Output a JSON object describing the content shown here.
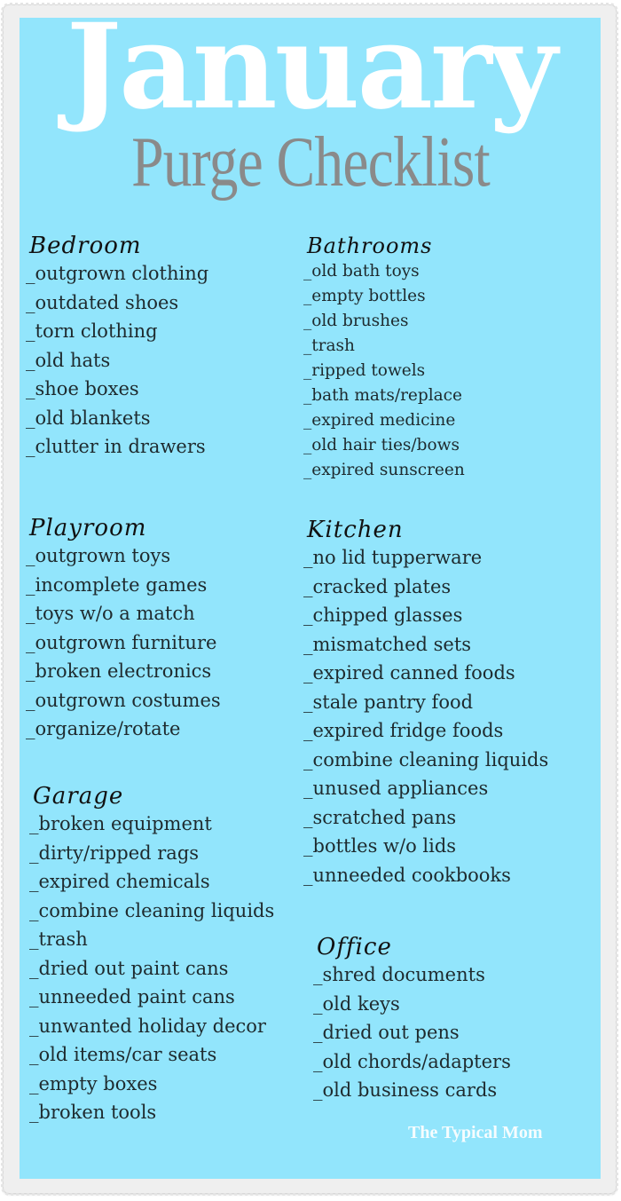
{
  "title": {
    "main": "January",
    "sub": "Purge Checklist"
  },
  "colors": {
    "background": "#92e5fc",
    "title_main": "#ffffff",
    "title_sub": "#8a8a8a",
    "text": "#1e2a2e",
    "frame": "#efefef"
  },
  "sections": {
    "bedroom": {
      "heading": "Bedroom",
      "items": [
        "_outgrown clothing",
        "_outdated shoes",
        "_torn clothing",
        "_old hats",
        "_shoe boxes",
        "_old blankets",
        "_clutter in drawers"
      ]
    },
    "bathrooms": {
      "heading": "Bathrooms",
      "items": [
        "_old bath toys",
        "_empty bottles",
        "_old brushes",
        "_trash",
        "_ripped towels",
        "_bath mats/replace",
        "_expired medicine",
        "_old hair ties/bows",
        "_expired sunscreen"
      ]
    },
    "playroom": {
      "heading": "Playroom",
      "items": [
        "_outgrown toys",
        "_incomplete games",
        "_toys w/o a match",
        "_outgrown furniture",
        "_broken electronics",
        "_outgrown costumes",
        "_organize/rotate"
      ]
    },
    "kitchen": {
      "heading": "Kitchen",
      "items": [
        "_no lid tupperware",
        "_cracked plates",
        "_chipped glasses",
        "_mismatched sets",
        "_expired canned foods",
        "_stale pantry food",
        "_expired fridge foods",
        "_combine cleaning liquids",
        "_unused appliances",
        "_scratched pans",
        "_bottles w/o lids",
        "_unneeded cookbooks"
      ]
    },
    "garage": {
      "heading": "Garage",
      "items": [
        "_broken equipment",
        "_dirty/ripped rags",
        "_expired chemicals",
        "_combine cleaning liquids",
        "_trash",
        "_dried out paint cans",
        "_unneeded paint cans",
        "_unwanted holiday decor",
        "_old items/car seats",
        "_empty boxes",
        "_broken tools"
      ]
    },
    "office": {
      "heading": "Office",
      "items": [
        "_shred documents",
        "_old keys",
        "_dried out pens",
        "_old chords/adapters",
        "_old business cards"
      ]
    }
  },
  "watermark": "The Typical Mom"
}
